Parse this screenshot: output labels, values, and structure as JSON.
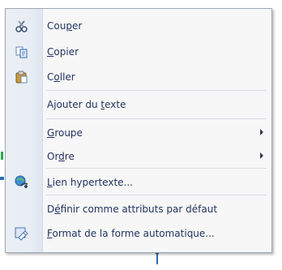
{
  "menu": {
    "items": [
      {
        "id": "cut",
        "label_pre": "Cou",
        "label_ul": "p",
        "label_post": "er",
        "icon": "scissors-icon",
        "has_submenu": false
      },
      {
        "id": "copy",
        "label_pre": "",
        "label_ul": "C",
        "label_post": "opier",
        "icon": "copy-icon",
        "has_submenu": false
      },
      {
        "id": "paste",
        "label_pre": "C",
        "label_ul": "o",
        "label_post": "ller",
        "icon": "paste-icon",
        "has_submenu": false
      },
      {
        "id": "add-text",
        "label_pre": "Ajouter du ",
        "label_ul": "t",
        "label_post": "exte",
        "icon": "",
        "has_submenu": false
      },
      {
        "id": "group",
        "label_pre": "",
        "label_ul": "G",
        "label_post": "roupe",
        "icon": "",
        "has_submenu": true
      },
      {
        "id": "order",
        "label_pre": "Or",
        "label_ul": "d",
        "label_post": "re",
        "icon": "",
        "has_submenu": true
      },
      {
        "id": "hyperlink",
        "label_pre": "",
        "label_ul": "L",
        "label_post": "ien hypertexte...",
        "icon": "hyperlink-globe-icon",
        "has_submenu": false
      },
      {
        "id": "set-default",
        "label_pre": "D",
        "label_ul": "é",
        "label_post": "finir comme attributs par défaut",
        "icon": "",
        "has_submenu": false
      },
      {
        "id": "format-autoshape",
        "label_pre": "",
        "label_ul": "F",
        "label_post": "ormat de la forme automatique...",
        "icon": "format-shape-icon",
        "has_submenu": false
      }
    ]
  },
  "colors": {
    "menu_text": "#22335f",
    "menu_background": "#f7f7f7",
    "gutter_background": "#e7edf4",
    "border": "#9fa7b3",
    "connector_green": "#2aa84a",
    "connector_blue": "#2f6fb2"
  }
}
